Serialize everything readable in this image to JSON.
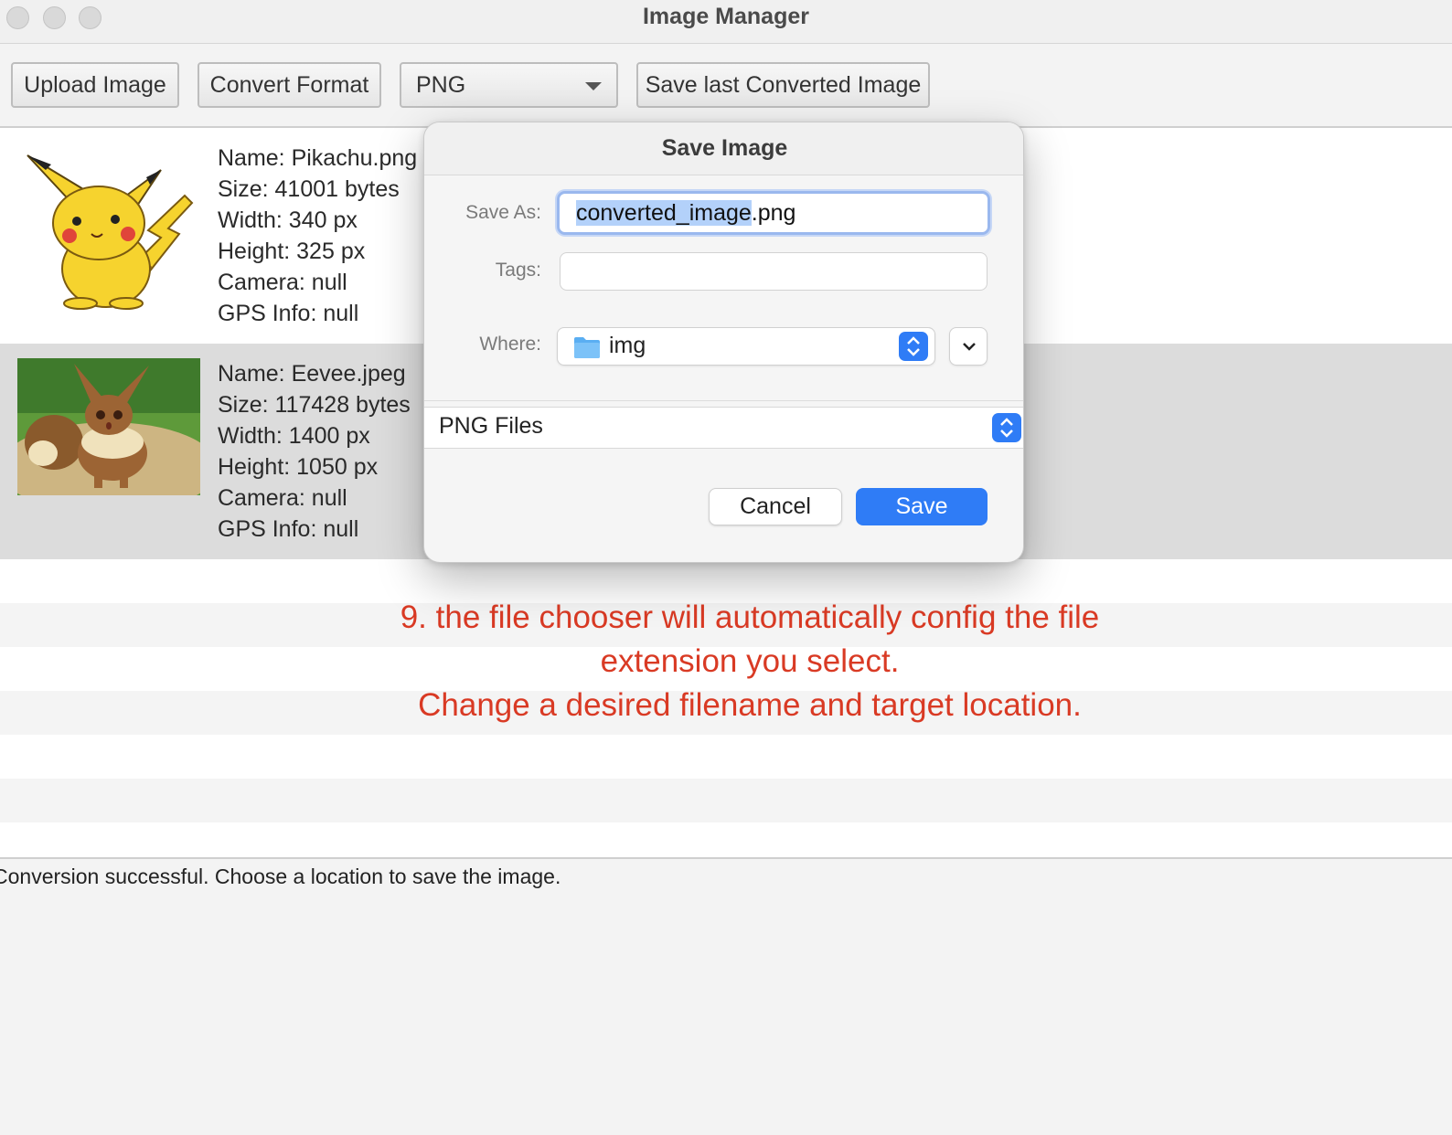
{
  "window": {
    "title": "Image Manager"
  },
  "toolbar": {
    "upload_label": "Upload Image",
    "convert_label": "Convert Format",
    "format_selected": "PNG",
    "save_converted_label": "Save last Converted Image"
  },
  "images": [
    {
      "name": "Name: Pikachu.png",
      "size": "Size: 41001 bytes",
      "width": "Width: 340 px",
      "height": "Height: 325 px",
      "camera": "Camera: null",
      "gps": "GPS Info: null"
    },
    {
      "name": "Name: Eevee.jpeg",
      "size": "Size: 117428 bytes",
      "width": "Width: 1400 px",
      "height": "Height: 1050 px",
      "camera": "Camera: null",
      "gps": "GPS Info: null"
    }
  ],
  "dialog": {
    "title": "Save Image",
    "save_as_label": "Save As:",
    "filename_selected": "converted_image",
    "filename_ext": ".png",
    "tags_label": "Tags:",
    "where_label": "Where:",
    "where_value": "img",
    "file_type": "PNG Files",
    "cancel_label": "Cancel",
    "save_label": "Save"
  },
  "annotation": {
    "line1": "9. the file chooser will automatically config the file",
    "line2": "extension you select.",
    "line3": "Change a desired filename and target location."
  },
  "status": {
    "text": "Conversion successful. Choose a location to save the image."
  },
  "colors": {
    "accent": "#2f7cf6",
    "annotation": "#d93a24",
    "selection_highlight": "#b3d1fa"
  }
}
